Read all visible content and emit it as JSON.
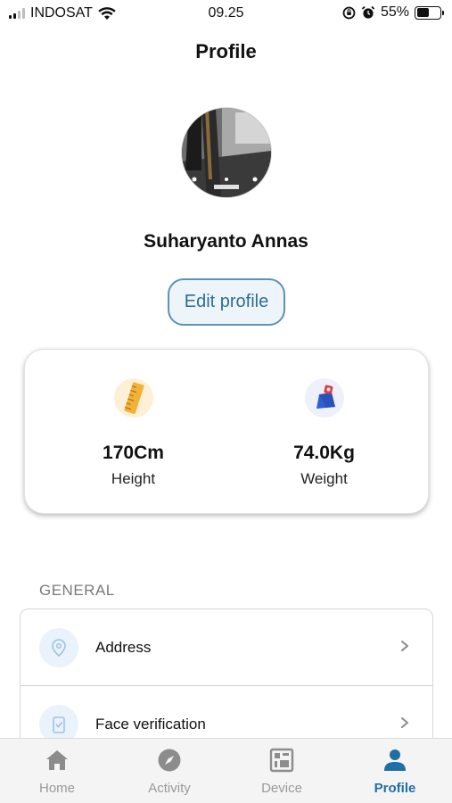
{
  "status_bar": {
    "carrier": "INDOSAT",
    "time": "09.25",
    "battery_percent": "55%",
    "battery_level": 0.55,
    "icons": [
      "signal-icon",
      "wifi-icon",
      "orientation-lock-icon",
      "alarm-icon",
      "battery-icon"
    ]
  },
  "header": {
    "title": "Profile"
  },
  "profile": {
    "name": "Suharyanto Annas",
    "edit_label": "Edit profile",
    "avatar_icon": "avatar-photo"
  },
  "stats": {
    "height": {
      "value": "170Cm",
      "label": "Height",
      "icon": "ruler-icon"
    },
    "weight": {
      "value": "74.0Kg",
      "label": "Weight",
      "icon": "weight-icon"
    }
  },
  "general": {
    "section_title": "GENERAL",
    "items": [
      {
        "label": "Address",
        "icon": "location-pin-icon"
      },
      {
        "label": "Face verification",
        "icon": "face-verification-icon"
      }
    ]
  },
  "bottom_nav": {
    "items": [
      {
        "label": "Home",
        "icon": "home-icon",
        "active": false
      },
      {
        "label": "Activity",
        "icon": "compass-icon",
        "active": false
      },
      {
        "label": "Device",
        "icon": "device-icon",
        "active": false
      },
      {
        "label": "Profile",
        "icon": "person-icon",
        "active": true
      }
    ]
  },
  "colors": {
    "accent": "#1f6fa6",
    "edit_border": "#5a93b5",
    "inactive": "#9a9a9a"
  }
}
